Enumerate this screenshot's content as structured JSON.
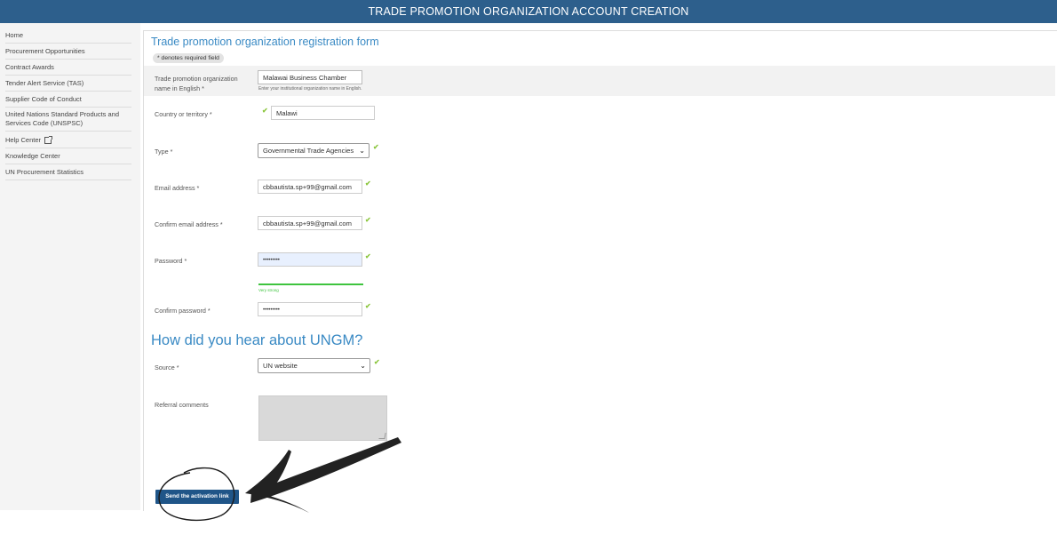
{
  "header": {
    "title": "TRADE PROMOTION ORGANIZATION ACCOUNT CREATION"
  },
  "sidebar": {
    "items": [
      {
        "label": "Home"
      },
      {
        "label": "Procurement Opportunities"
      },
      {
        "label": "Contract Awards"
      },
      {
        "label": "Tender Alert Service (TAS)"
      },
      {
        "label": "Supplier Code of Conduct"
      },
      {
        "label": "United Nations Standard Products and Services Code (UNSPSC)"
      },
      {
        "label": "Help Center",
        "icon": "external-link-icon"
      },
      {
        "label": "Knowledge Center"
      },
      {
        "label": "UN Procurement Statistics"
      }
    ]
  },
  "form": {
    "title": "Trade promotion organization registration form",
    "required_note": "* denotes required field",
    "name": {
      "label": "Trade promotion organization name in English *",
      "value": "Malawai Business Chamber",
      "hint": "Enter your institutional organization name in English."
    },
    "country": {
      "label": "Country or territory *",
      "value": "Malawi"
    },
    "type": {
      "label": "Type *",
      "value": "Governmental Trade Agencies"
    },
    "email": {
      "label": "Email address *",
      "value": "cbbautista.sp+99@gmail.com"
    },
    "confirm_email": {
      "label": "Confirm email address *",
      "value": "cbbautista.sp+99@gmail.com"
    },
    "password": {
      "label": "Password *",
      "value": "•••••••••",
      "strength": "Very strong"
    },
    "confirm_password": {
      "label": "Confirm password *",
      "value": "•••••••••"
    },
    "hear_title": "How did you hear about UNGM?",
    "source": {
      "label": "Source *",
      "value": "UN website"
    },
    "referral": {
      "label": "Referral comments",
      "value": ""
    },
    "submit_label": "Send the activation link"
  },
  "colors": {
    "header_bg": "#2d5f8c",
    "accent": "#3a8ac4",
    "button_bg": "#1f5588",
    "valid_check": "#8cc63f"
  }
}
